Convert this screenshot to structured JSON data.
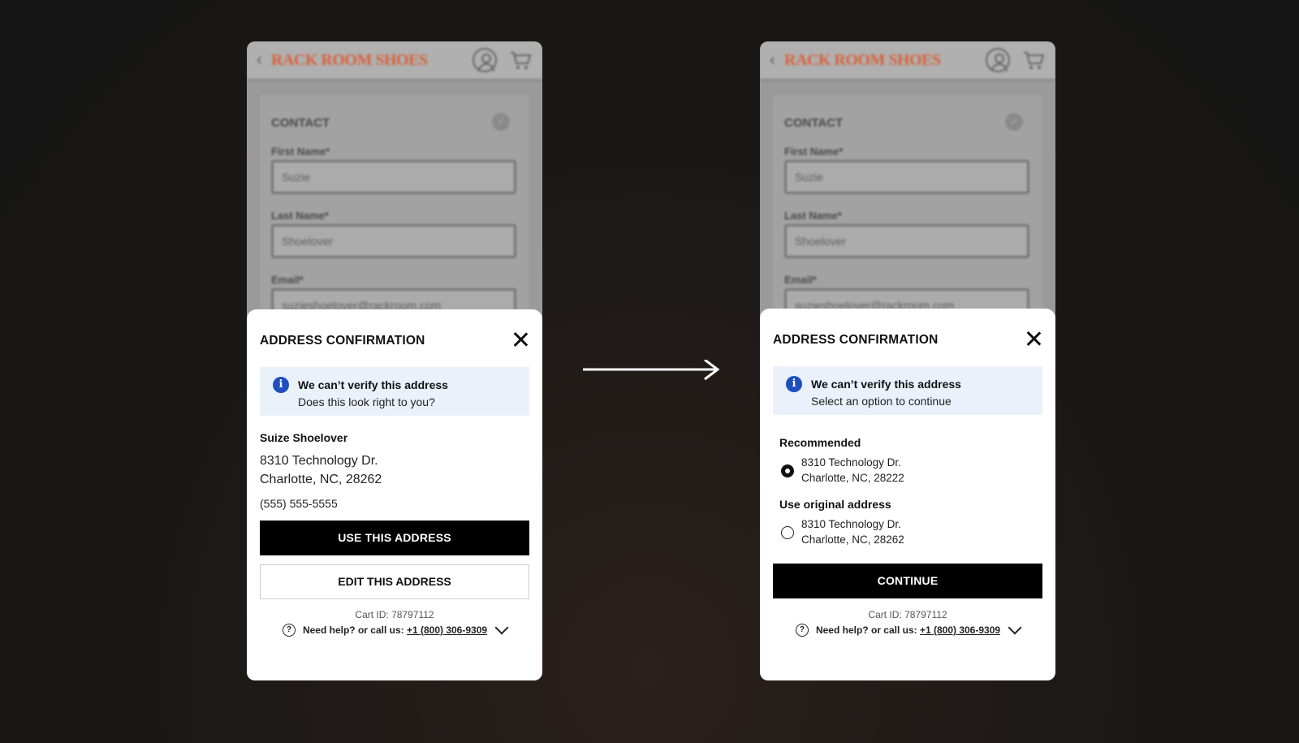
{
  "brand": "RACK ROOM SHOES",
  "background_form": {
    "section_title": "CONTACT",
    "first_name_label": "First Name*",
    "first_name_value": "Suzie",
    "last_name_label": "Last Name*",
    "last_name_value": "Shoelover",
    "email_label": "Email*",
    "email_value": "suzieshoelover@rackroom.com"
  },
  "left_modal": {
    "title": "ADDRESS CONFIRMATION",
    "info_heading": "We can’t verify this address",
    "info_subtext": "Does this look right to you?",
    "name": "Suize Shoelover",
    "address_line1": "8310 Technology Dr.",
    "address_line2": "Charlotte, NC, 28262",
    "phone": "(555) 555-5555",
    "use_button": "USE THIS ADDRESS",
    "edit_button": "EDIT THIS ADDRESS",
    "cart_id": "Cart ID: 78797112",
    "help_prefix": "Need help? or call us: ",
    "help_phone": "+1 (800) 306-9309"
  },
  "right_modal": {
    "title": "ADDRESS CONFIRMATION",
    "info_heading": "We can’t verify this address",
    "info_subtext": "Select an option to continue",
    "recommended_label": "Recommended",
    "recommended_line1": "8310 Technology Dr.",
    "recommended_line2": "Charlotte, NC, 28222",
    "recommended_selected": true,
    "original_label": "Use original address",
    "original_line1": "8310 Technology Dr.",
    "original_line2": "Charlotte, NC, 28262",
    "original_selected": false,
    "continue_button": "CONTINUE",
    "cart_id": "Cart ID: 78797112",
    "help_prefix": "Need help? or call us: ",
    "help_phone": "+1 (800) 306-9309"
  },
  "colors": {
    "brand": "#d9623a",
    "info_bg": "#eaf1fb",
    "info_icon": "#1f4fbf",
    "primary_button": "#000000"
  },
  "icons": [
    "back-chevron-icon",
    "user-icon",
    "cart-icon",
    "check-icon",
    "close-icon",
    "info-icon",
    "help-icon",
    "chevron-down-icon",
    "arrow-right-icon"
  ]
}
